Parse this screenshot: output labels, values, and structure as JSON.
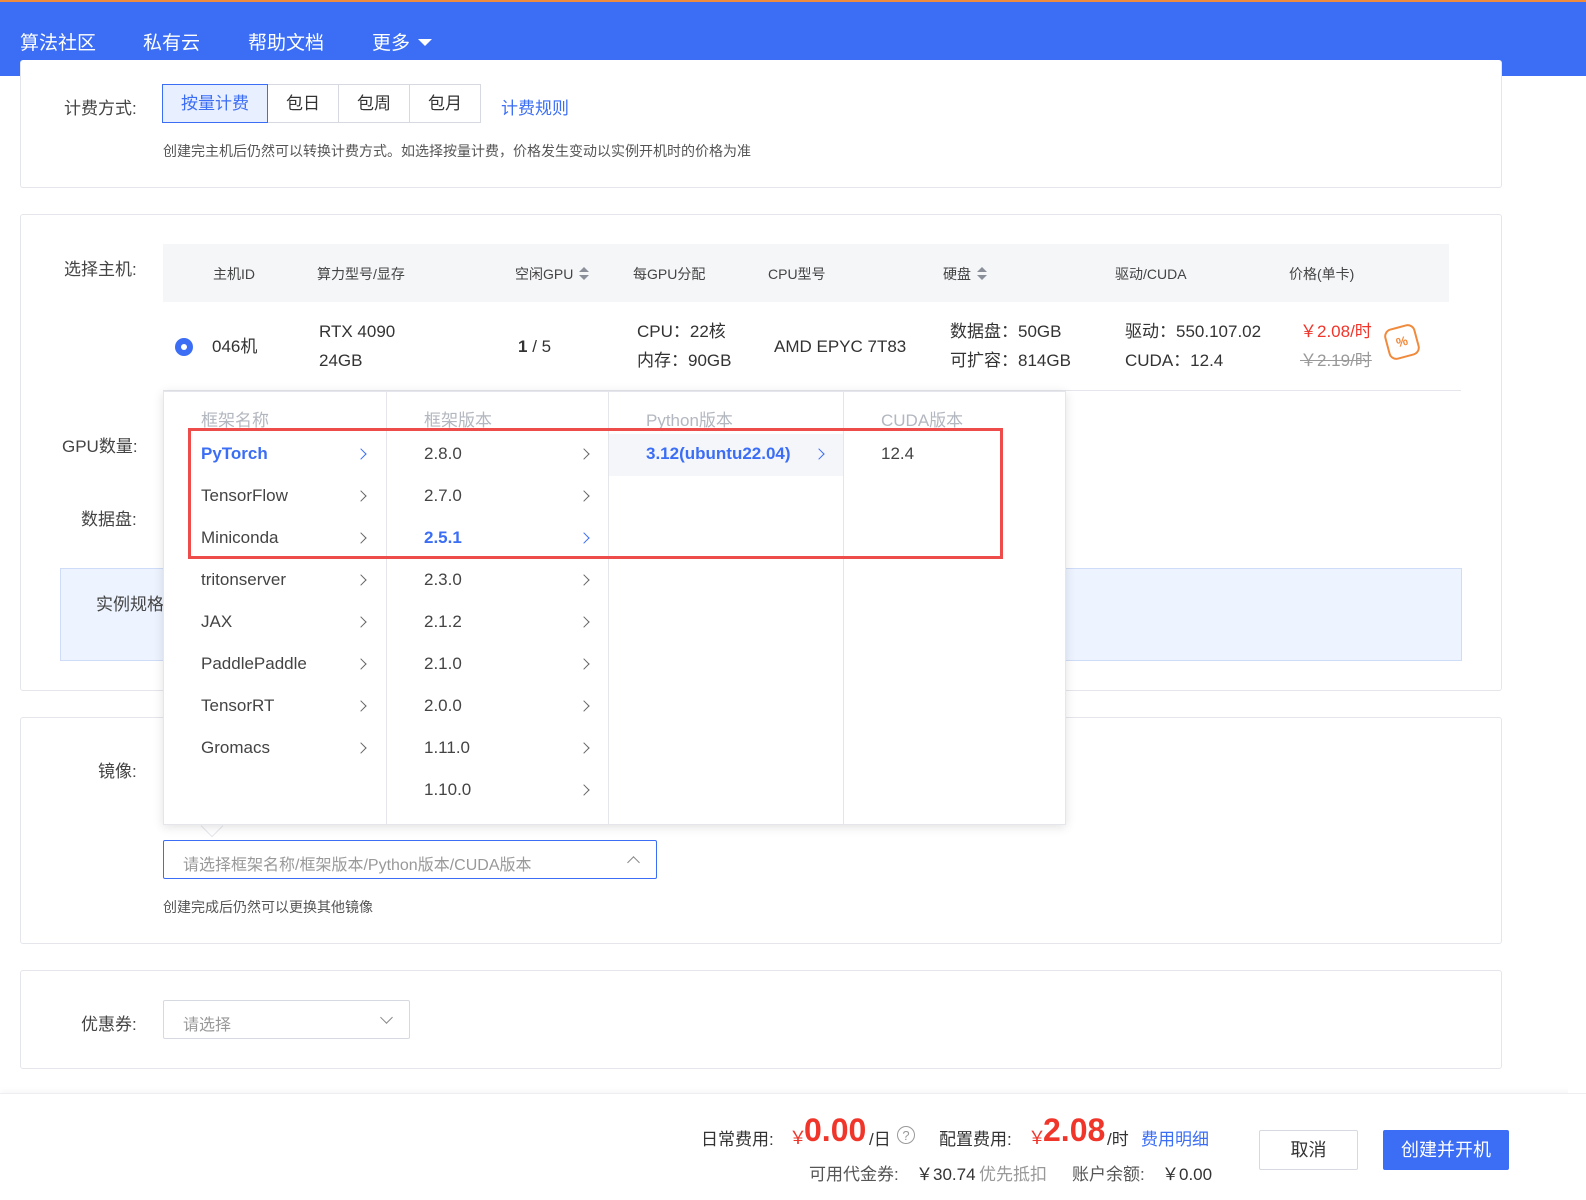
{
  "nav": {
    "items": [
      "算法社区",
      "私有云",
      "帮助文档",
      "更多"
    ]
  },
  "billing": {
    "label": "计费方式:",
    "tabs": [
      "按量计费",
      "包日",
      "包周",
      "包月"
    ],
    "rules_link": "计费规则",
    "hint": "创建完主机后仍然可以转换计费方式。如选择按量计费，价格发生变动以实例开机时的价格为准"
  },
  "host": {
    "label": "选择主机:",
    "columns": [
      "主机ID",
      "算力型号/显存",
      "空闲GPU",
      "每GPU分配",
      "CPU型号",
      "硬盘",
      "驱动/CUDA",
      "价格(单卡)"
    ],
    "row": {
      "id": "046机",
      "gpu_model": "RTX 4090",
      "vram": "24GB",
      "free_gpu": "1",
      "total_gpu": " / 5",
      "cpu_alloc": "CPU：22核",
      "mem_alloc": "内存：90GB",
      "cpu_model": "AMD EPYC 7T83",
      "disk_data": "数据盘：50GB",
      "disk_expand": "可扩容：814GB",
      "driver": "驱动：550.107.02",
      "cuda": "CUDA：12.4",
      "price": "￥2.08/时",
      "price_old": "￥2.19/时",
      "coupon_glyph": "%"
    }
  },
  "gpu_count_label": "GPU数量:",
  "data_disk_label": "数据盘:",
  "spec_label": "实例规格",
  "image": {
    "label": "镜像:",
    "placeholder": "请选择框架名称/框架版本/Python版本/CUDA版本",
    "hint": "创建完成后仍然可以更换其他镜像"
  },
  "cascader": {
    "headers": [
      "框架名称",
      "框架版本",
      "Python版本",
      "CUDA版本"
    ],
    "frameworks": [
      "PyTorch",
      "TensorFlow",
      "Miniconda",
      "tritonserver",
      "JAX",
      "PaddlePaddle",
      "TensorRT",
      "Gromacs"
    ],
    "versions": [
      "2.8.0",
      "2.7.0",
      "2.5.1",
      "2.3.0",
      "2.1.2",
      "2.1.0",
      "2.0.0",
      "1.11.0",
      "1.10.0"
    ],
    "python": [
      "3.12(ubuntu22.04)"
    ],
    "cuda": [
      "12.4"
    ],
    "selected_framework": "PyTorch",
    "selected_version": "2.5.1",
    "selected_python": "3.12(ubuntu22.04)"
  },
  "coupon": {
    "label": "优惠券:",
    "placeholder": "请选择"
  },
  "footer": {
    "daily_label": "日常费用:",
    "daily_yen": "￥",
    "daily_value": "0.00",
    "daily_unit": "/日",
    "help": "?",
    "config_label": "配置费用:",
    "config_yen": "￥",
    "config_value": "2.08",
    "config_unit": "/时",
    "detail_link": "费用明细",
    "voucher_label": "可用代金券:",
    "voucher_value": "￥30.74",
    "voucher_note": "优先抵扣",
    "balance_label": "账户余额:",
    "balance_value": "￥0.00",
    "cancel": "取消",
    "create": "创建并开机"
  }
}
